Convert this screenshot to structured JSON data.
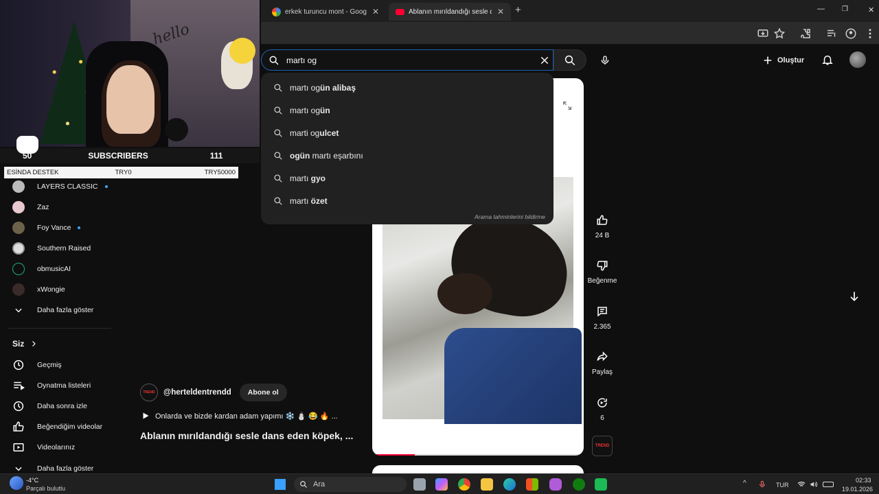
{
  "browser": {
    "tabs": [
      {
        "title": "erkek turuncu mont - Google'd",
        "active": false,
        "favicon": "google-icon"
      },
      {
        "title": "Ablanın mırıldandığı sesle dans",
        "active": true,
        "favicon": "youtube-icon"
      }
    ],
    "new_tab": "+",
    "window_controls": {
      "minimize": "—",
      "restore": "❐",
      "close": "✕"
    }
  },
  "youtube": {
    "search": {
      "query": "martı og"
    },
    "create_label": "Oluştur",
    "suggestions": [
      {
        "prefix": "martı og",
        "rest": "ün alibaş"
      },
      {
        "prefix": "martı og",
        "rest": "ün"
      },
      {
        "prefix": "marti og",
        "rest": "ulcet"
      },
      {
        "prefix": "ogün ",
        "rest": "martı eşarbını",
        "bold_first": true
      },
      {
        "prefix": "martı ",
        "rest": "gyo"
      },
      {
        "prefix": "martı ",
        "rest": "özet"
      }
    ],
    "suggestions_footer": "Arama tahminlerini bildirme",
    "short": {
      "channel": "@herteldentrendd",
      "subscribe_label": "Abone ol",
      "description": "Onlarda ve bizde kardan adam yapımı ❄️ ⛄ 😂 🔥 ...",
      "title": "Ablanın mırıldandığı sesle dans eden köpek, ...",
      "likes": "24 B",
      "dislike_label": "Beğenme",
      "comments": "2.365",
      "share_label": "Paylaş",
      "remix_count": "6",
      "progress": 0.2
    },
    "sidebar": {
      "subscriptions": [
        {
          "name": "LAYERS CLASSIC",
          "new": true
        },
        {
          "name": "Zaz",
          "new": false
        },
        {
          "name": "Foy Vance",
          "new": true
        },
        {
          "name": "Southern Raised",
          "new": false
        },
        {
          "name": "obmusicAI",
          "new": false
        },
        {
          "name": "xWongie",
          "new": false
        }
      ],
      "show_more_1": "Daha fazla göster",
      "you_heading": "Siz",
      "you_items": [
        "Geçmiş",
        "Oynatma listeleri",
        "Daha sonra izle",
        "Beğendiğim videolar",
        "Videolarınız"
      ],
      "show_more_2": "Daha fazla göster"
    }
  },
  "stream_overlay": {
    "sub_count_left": "50",
    "sub_label": "SUBSCRIBERS",
    "sub_count_right": "111",
    "donation_label": "ESİNDA DESTEK",
    "donation_mid": "TRY0",
    "donation_goal": "TRY50000",
    "hello_sign": "hello"
  },
  "taskbar": {
    "weather_temp": "-4°C",
    "weather_desc": "Parçalı bulutlu",
    "search_placeholder": "Ara",
    "language": "TUR",
    "time": "02:33",
    "date": "19.01.2026"
  }
}
